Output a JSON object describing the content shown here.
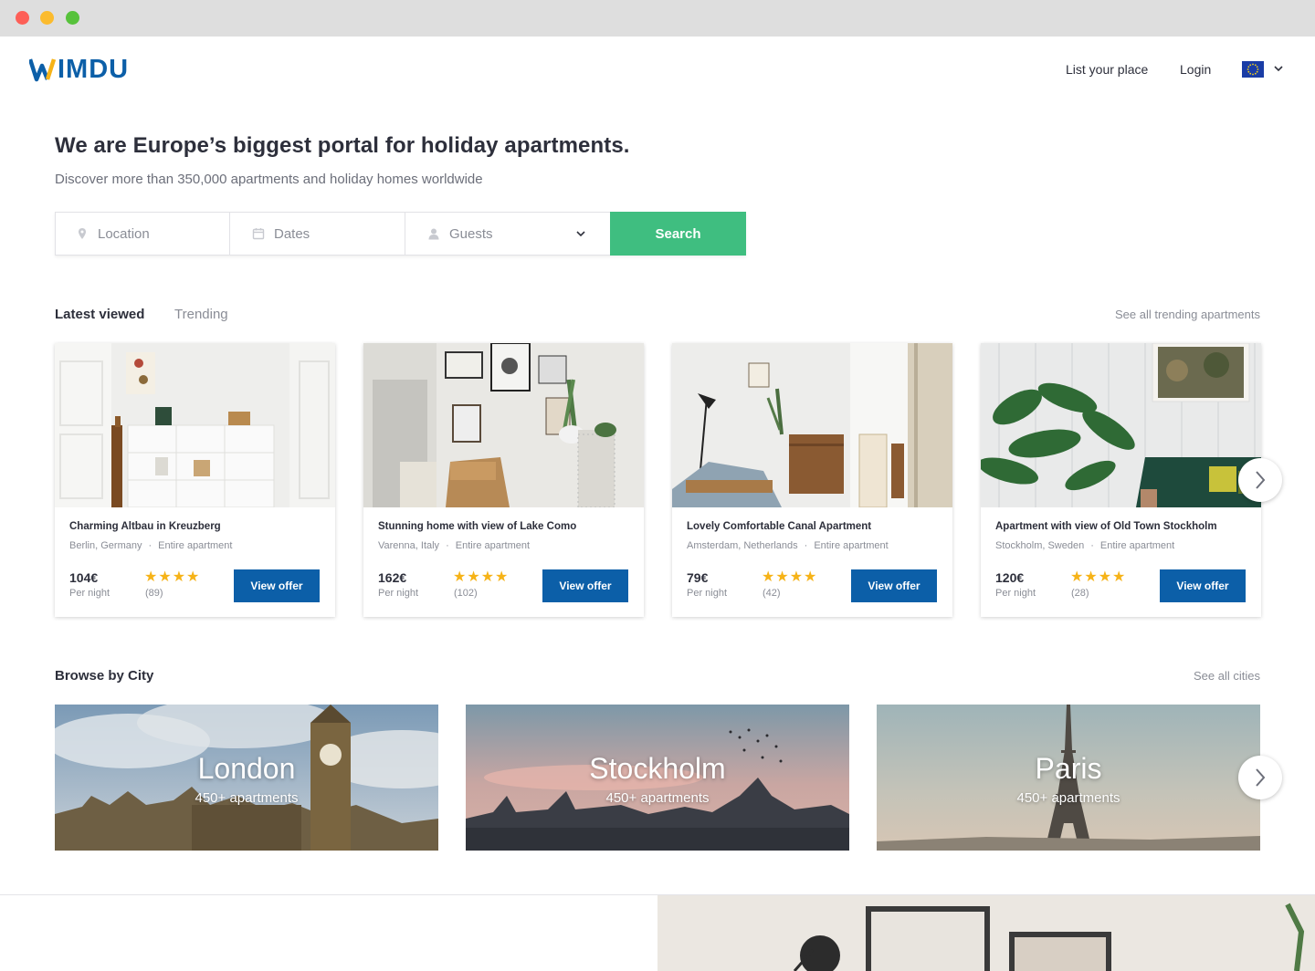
{
  "header": {
    "logo_text": "WIMDU",
    "nav": {
      "list_place": "List your place",
      "login": "Login"
    },
    "language_flag": "eu-flag-icon"
  },
  "hero": {
    "title": "We are Europe’s biggest portal for holiday apartments.",
    "subtitle": "Discover more than 350,000 apartments and holiday homes worldwide"
  },
  "search": {
    "location_placeholder": "Location",
    "dates_placeholder": "Dates",
    "guests_placeholder": "Guests",
    "button_label": "Search"
  },
  "tabs": {
    "latest": "Latest viewed",
    "trending": "Trending",
    "see_all": "See all trending apartments"
  },
  "listings": [
    {
      "title": "Charming Altbau in Kreuzberg",
      "location": "Berlin, Germany",
      "type": "Entire apartment",
      "price": "104€",
      "per": "Per night",
      "stars": "★★★★",
      "reviews": "(89)",
      "button": "View offer"
    },
    {
      "title": "Stunning home with view of Lake Como",
      "location": "Varenna, Italy",
      "type": "Entire apartment",
      "price": "162€",
      "per": "Per night",
      "stars": "★★★★",
      "reviews": "(102)",
      "button": "View offer"
    },
    {
      "title": "Lovely Comfortable Canal Apartment",
      "location": "Amsterdam, Netherlands",
      "type": "Entire apartment",
      "price": "79€",
      "per": "Per night",
      "stars": "★★★★",
      "reviews": "(42)",
      "button": "View offer"
    },
    {
      "title": "Apartment with view of Old Town Stockholm",
      "location": "Stockholm, Sweden",
      "type": "Entire apartment",
      "price": "120€",
      "per": "Per night",
      "stars": "★★★★",
      "reviews": "(28)",
      "button": "View offer"
    }
  ],
  "cities": {
    "title": "Browse by City",
    "see_all": "See all cities",
    "items": [
      {
        "name": "London",
        "count": "450+ apartments"
      },
      {
        "name": "Stockholm",
        "count": "450+ apartments"
      },
      {
        "name": "Paris",
        "count": "450+ apartments"
      }
    ]
  },
  "colors": {
    "brand_blue": "#0c5fa8",
    "logo_yellow": "#f6b318",
    "search_green": "#3fbe80",
    "star": "#f6b318"
  }
}
